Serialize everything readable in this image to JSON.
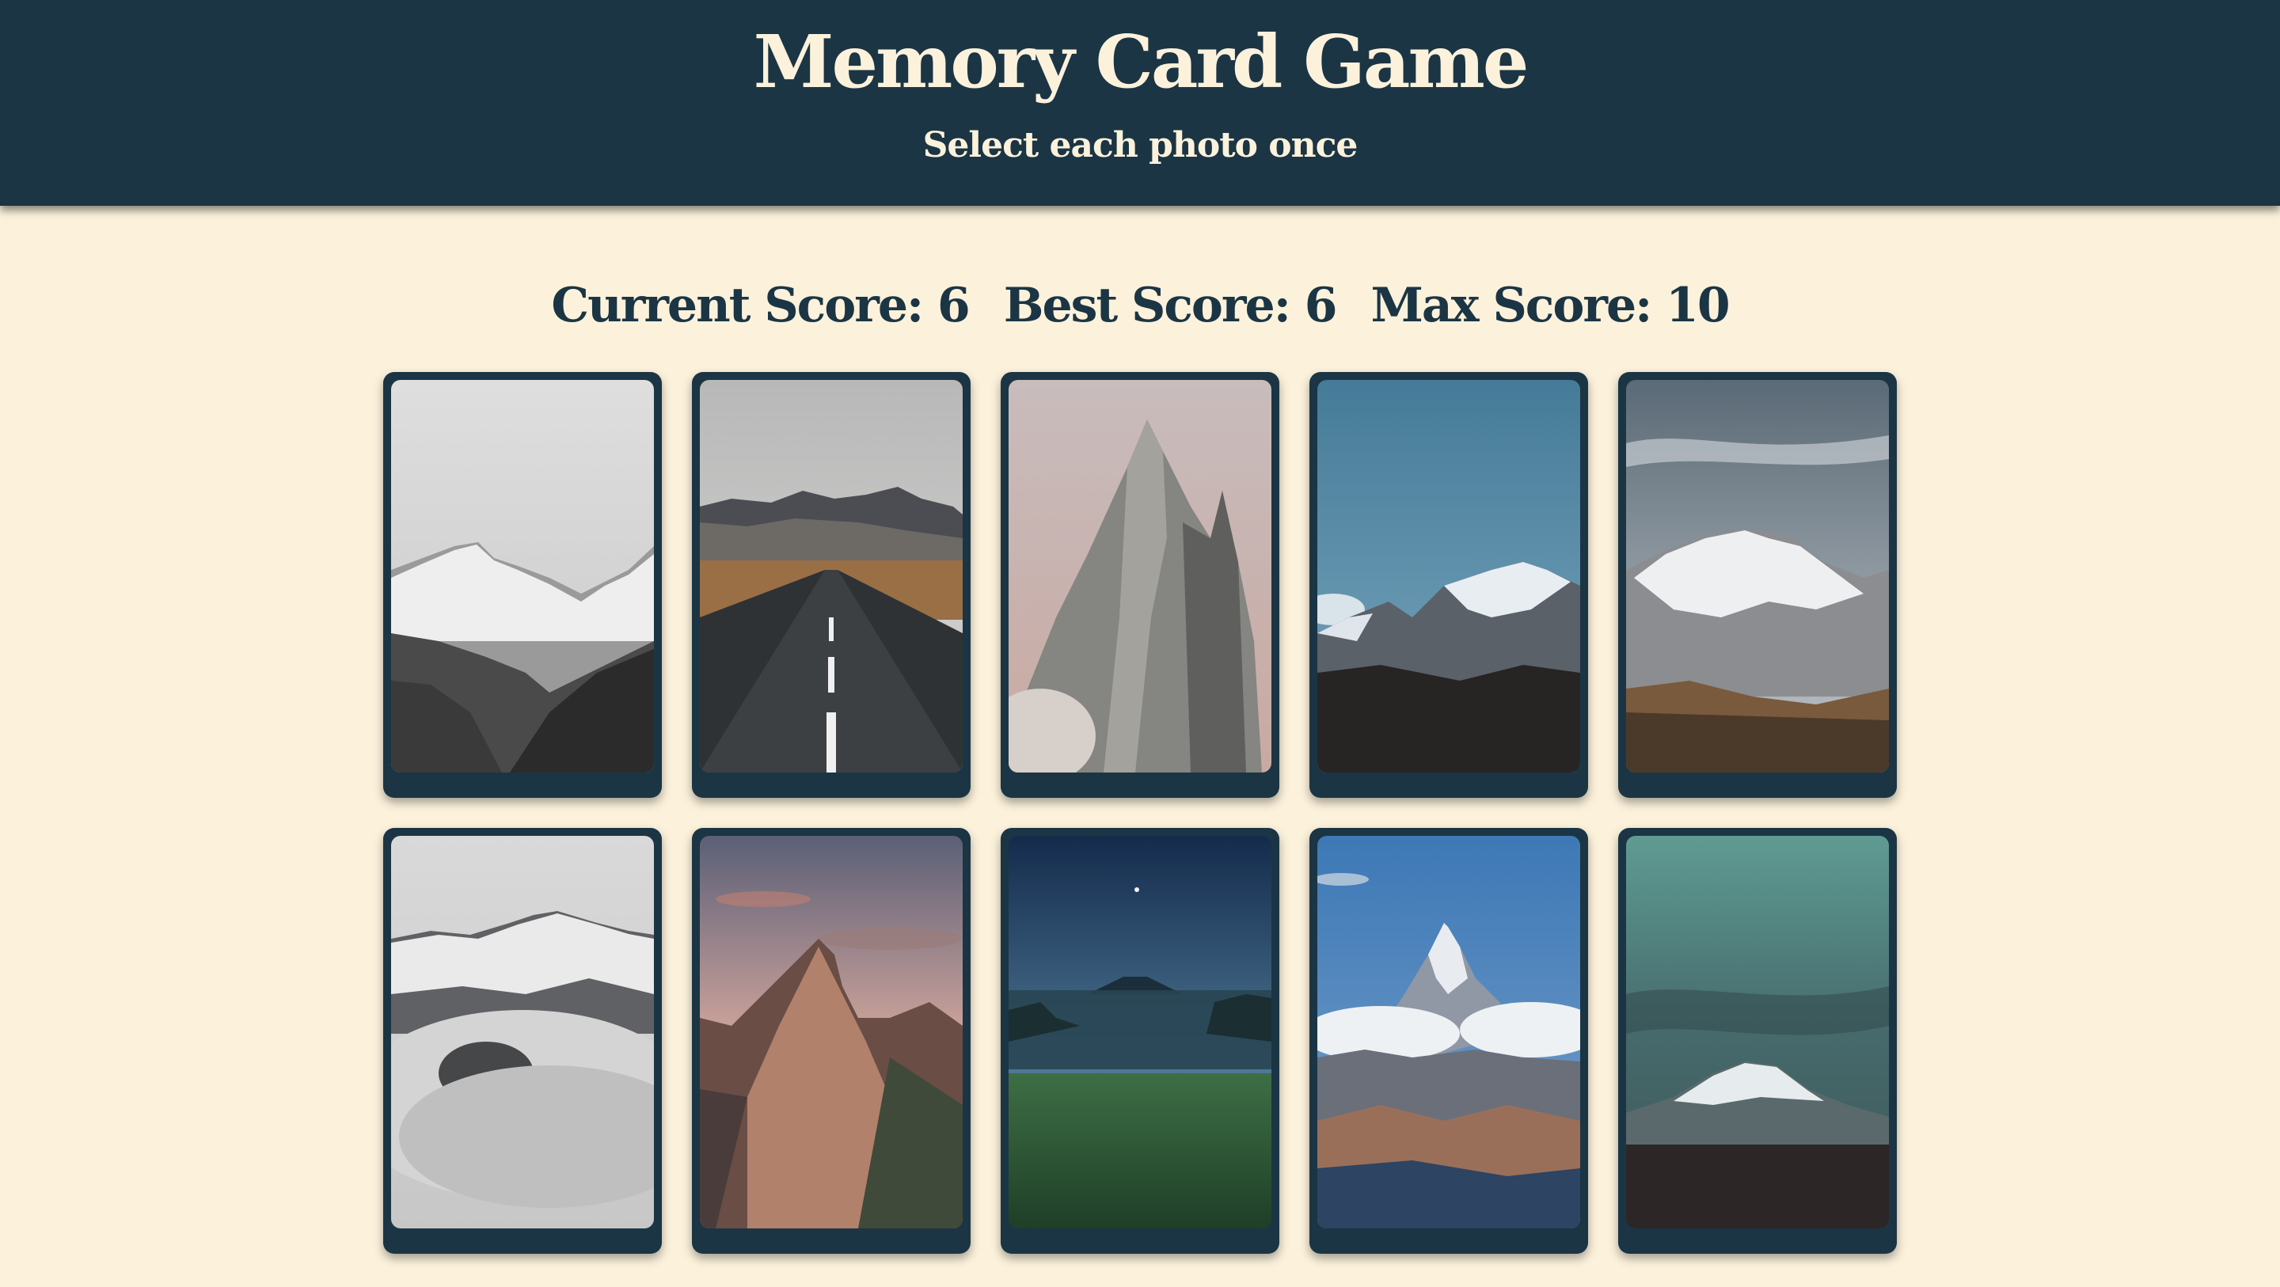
{
  "header": {
    "title": "Memory Card Game",
    "subtitle": "Select each photo once"
  },
  "scoreboard": {
    "current": "Current Score: 6",
    "best": "Best Score: 6",
    "max": "Max Score: 10"
  },
  "colors": {
    "header_bg": "#1b3544",
    "page_bg": "#fcf2dc",
    "text_light": "#fcf2dc",
    "text_dark": "#1b3544"
  },
  "cards": [
    {
      "image": "black-and-white-snowy-mountains-photo"
    },
    {
      "image": "straight-road-to-mountains-photo"
    },
    {
      "image": "jagged-rock-peak-pink-sky-photo"
    },
    {
      "image": "snow-peak-blue-sky-photo"
    },
    {
      "image": "snowy-massif-cloudy-sky-photo"
    },
    {
      "image": "mountains-above-clouds-photo"
    },
    {
      "image": "rocky-ridge-sunset-photo"
    },
    {
      "image": "volcano-night-meadow-photo"
    },
    {
      "image": "pointed-peak-above-clouds-photo"
    },
    {
      "image": "snowcap-teal-sky-photo"
    }
  ]
}
